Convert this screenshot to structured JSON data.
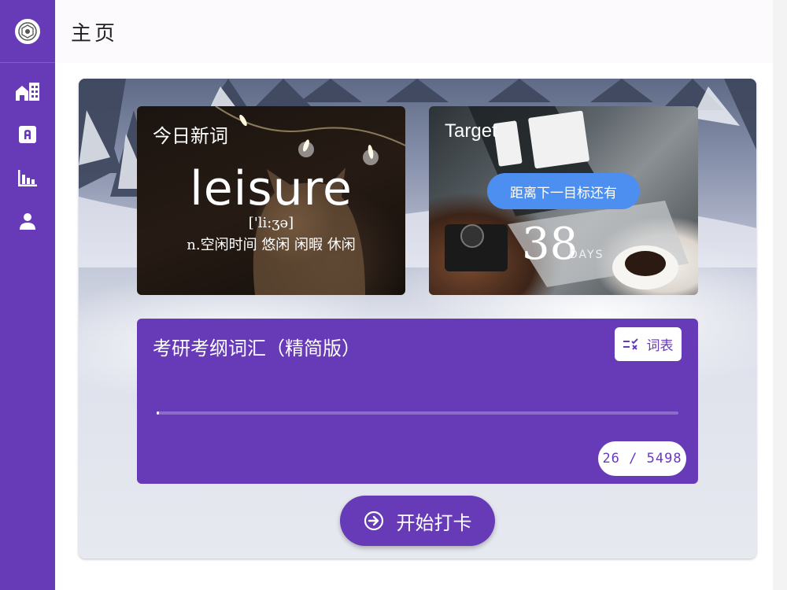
{
  "header": {
    "title": "主页"
  },
  "sidebar": {
    "logo": "app-logo",
    "items": [
      {
        "icon": "home-city-icon"
      },
      {
        "icon": "alpha-a-box-icon"
      },
      {
        "icon": "bar-chart-icon"
      },
      {
        "icon": "account-icon"
      }
    ]
  },
  "word_card": {
    "label": "今日新词",
    "word": "leisure",
    "phonetic": "['li:ʒə]",
    "meaning": "n.空闲时间 悠闲 闲暇 休闲"
  },
  "target_card": {
    "label": "Target",
    "pill_text": "距离下一目标还有",
    "days": "38",
    "days_label": "DAYS"
  },
  "vocab_card": {
    "title": "考研考纲词汇（精简版）",
    "wordlist_button": "词表",
    "learned": 26,
    "total": 5498,
    "count_text": "26 / 5498"
  },
  "start_button": {
    "label": "开始打卡"
  },
  "colors": {
    "primary": "#673ab7",
    "target_pill": "#4d8ff0",
    "header_bg": "#fcfafd"
  }
}
